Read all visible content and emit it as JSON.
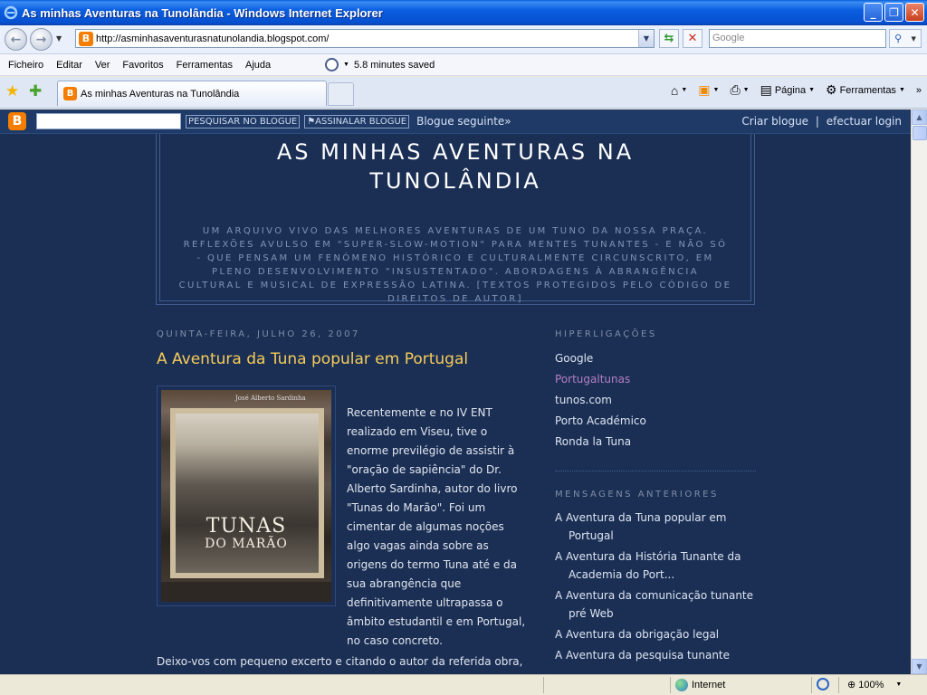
{
  "window": {
    "title": "As minhas Aventuras na Tunolândia - Windows Internet Explorer",
    "minimize": "_",
    "maximize": "❐",
    "close": "✕"
  },
  "address_bar": {
    "url": "http://asminhasaventurasnatunolandia.blogspot.com/",
    "search_placeholder": "Google"
  },
  "menu": {
    "items": [
      "Ficheiro",
      "Editar",
      "Ver",
      "Favoritos",
      "Ferramentas",
      "Ajuda"
    ],
    "history_text": "5.8 minutes saved"
  },
  "tabs": {
    "active_label": "As minhas Aventuras na Tunolândia"
  },
  "commands": {
    "page": "Página",
    "tools": "Ferramentas"
  },
  "blogger_nav": {
    "search_button": "PESQUISAR NO BLOGUE",
    "flag_button": "ASSINALAR BLOGUE",
    "next_blog": "Blogue seguinte»",
    "create_blog": "Criar blogue",
    "separator": "|",
    "login": "efectuar login"
  },
  "blog": {
    "title": "AS MINHAS AVENTURAS NA TUNOLÂNDIA",
    "description": "UM ARQUIVO VIVO DAS MELHORES AVENTURAS DE UM TUNO DA NOSSA PRAÇA. REFLEXÕES AVULSO EM \"SUPER-SLOW-MOTION\" PARA MENTES TUNANTES - E NÃO SÓ - QUE PENSAM UM FENÓMENO HISTÓRICO E CULTURALMENTE CIRCUNSCRITO, EM PLENO DESENVOLVIMENTO \"INSUSTENTADO\". ABORDAGENS À ABRANGÊNCIA CULTURAL E MUSICAL DE EXPRESSÃO LATINA. [TEXTOS PROTEGIDOS PELO CÓDIGO DE DIREITOS DE AUTOR]"
  },
  "post": {
    "date": "QUINTA-FEIRA, JULHO 26, 2007",
    "title": "A Aventura da Tuna popular em Portugal",
    "image_book_author": "José Alberto Sardinha",
    "image_book_title": "TUNAS",
    "image_book_subtitle": "DO MARÃO",
    "body_1": "Recentemente e no IV ENT realizado em Viseu, tive o enorme previlégio de assistir à \"oração de sapiência\" do Dr. Alberto Sardinha, autor do livro \"Tunas do Marão\". Foi um cimentar de algumas noções algo vagas ainda sobre as origens do termo Tuna até e da sua abrangência que definitivamente ultrapassa o âmbito estudantil e em Portugal, no caso concreto.",
    "body_2": "Deixo-vos com pequeno excerto e citando o autor da referida obra,"
  },
  "sidebar": {
    "links_heading": "HIPERLIGAÇÕES",
    "links": [
      "Google",
      "Portugaltunas",
      "tunos.com",
      "Porto Académico",
      "Ronda la Tuna"
    ],
    "archive_heading": "MENSAGENS ANTERIORES",
    "archive": [
      "A Aventura da Tuna popular em Portugal",
      "A Aventura da História Tunante da Academia do Port...",
      "A Aventura da comunicação tunante pré Web",
      "A Aventura da obrigação legal",
      "A Aventura da pesquisa tunante"
    ]
  },
  "status": {
    "zone": "Internet",
    "zoom": "100%"
  },
  "colors": {
    "page_bg": "#1b2f55",
    "post_title": "#f6cc58",
    "visited_link": "#b57fbf",
    "blogger_orange": "#f57d00"
  }
}
